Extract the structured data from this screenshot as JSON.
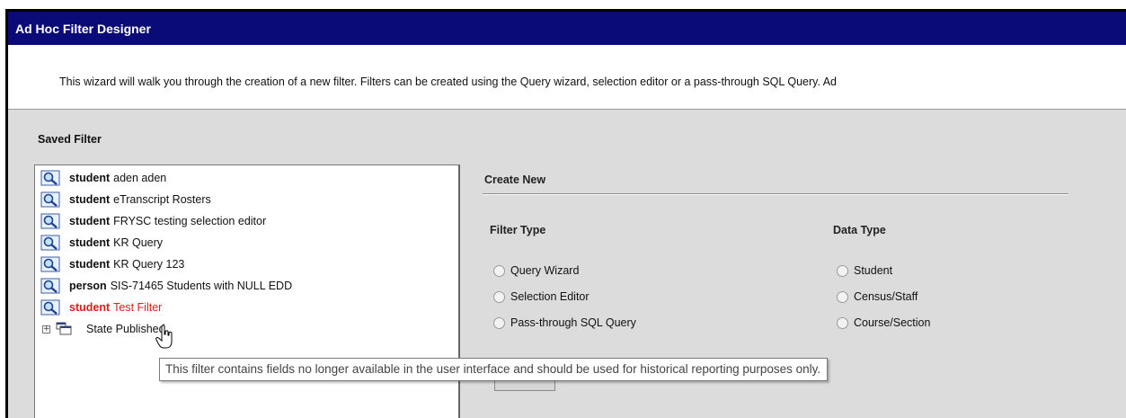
{
  "window": {
    "title": "Ad Hoc Filter Designer",
    "intro": "This wizard will walk you through the creation of a new filter. Filters can be created using the Query wizard, selection editor or a pass-through SQL Query. Ad"
  },
  "saved_filter": {
    "heading": "Saved Filter",
    "items": [
      {
        "type": "student",
        "name": "aden aden",
        "icon": "magnifier-icon"
      },
      {
        "type": "student",
        "name": "eTranscript Rosters",
        "icon": "magnifier-icon"
      },
      {
        "type": "student",
        "name": "FRYSC testing selection editor",
        "icon": "magnifier-icon"
      },
      {
        "type": "student",
        "name": "KR Query",
        "icon": "magnifier-icon"
      },
      {
        "type": "student",
        "name": "KR Query 123",
        "icon": "magnifier-icon"
      },
      {
        "type": "person",
        "name": "SIS-71465 Students with NULL EDD",
        "icon": "magnifier-icon"
      },
      {
        "type": "student",
        "name": "Test Filter",
        "icon": "magnifier-icon",
        "color": "#e31b1b"
      }
    ],
    "folder": {
      "expander": "+",
      "label": "State Published",
      "icon": "folder-stack-icon"
    }
  },
  "create_new": {
    "heading": "Create New",
    "filter_type": {
      "heading": "Filter Type",
      "options": [
        "Query Wizard",
        "Selection Editor",
        "Pass-through SQL Query"
      ]
    },
    "data_type": {
      "heading": "Data Type",
      "options": [
        "Student",
        "Census/Staff",
        "Course/Section"
      ]
    }
  },
  "tooltip": "This filter contains fields no longer available in the user interface and should be used for historical reporting purposes only.",
  "cursor_icon": "hand-pointer-icon",
  "colors": {
    "titlebar": "#0a0a78",
    "panel": "#dcdcdc",
    "deprecated_filter": "#e31b1b"
  }
}
